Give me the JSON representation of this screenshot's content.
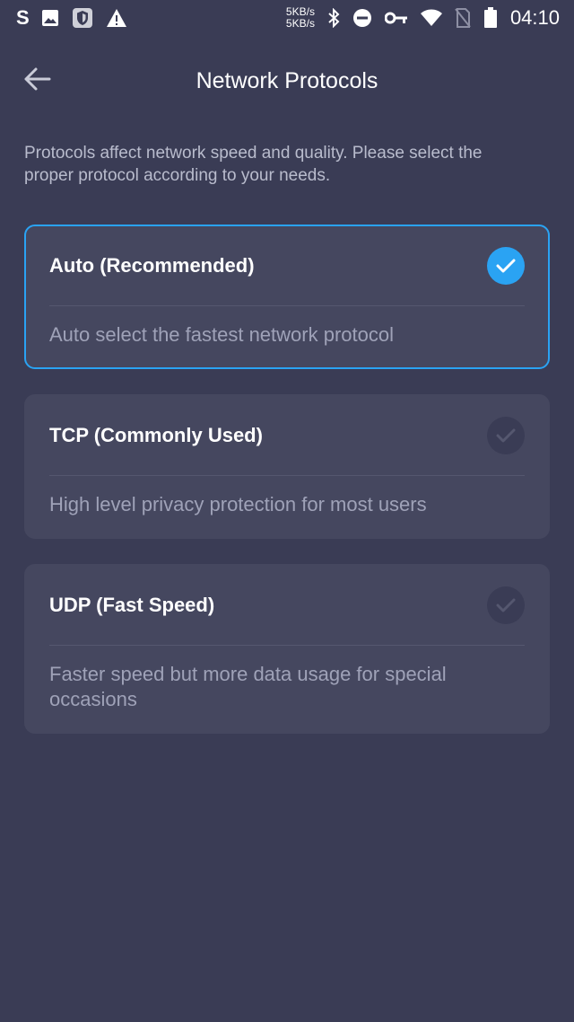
{
  "status_bar": {
    "net_up": "5KB/s",
    "net_down": "5KB/s",
    "time": "04:10",
    "battery_level": "77",
    "icons": [
      "s-app-icon",
      "gallery-icon",
      "shield-icon",
      "warning-icon",
      "bluetooth-icon",
      "dnd-icon",
      "vpn-key-icon",
      "wifi-icon",
      "no-sim-icon",
      "battery-icon"
    ]
  },
  "header": {
    "title": "Network Protocols",
    "back_icon": "arrow-left-icon"
  },
  "description": "Protocols affect network speed and quality. Please select the proper protocol according to your needs.",
  "protocols": [
    {
      "title": "Auto (Recommended)",
      "description": "Auto select the fastest network protocol",
      "selected": true
    },
    {
      "title": "TCP (Commonly Used)",
      "description": "High level privacy protection for most users",
      "selected": false
    },
    {
      "title": "UDP (Fast Speed)",
      "description": "Faster speed but more data usage for special occasions",
      "selected": false
    }
  ],
  "colors": {
    "background": "#3a3c55",
    "card": "#45475f",
    "accent": "#2aa3f3",
    "description_text": "#b9bccd"
  }
}
